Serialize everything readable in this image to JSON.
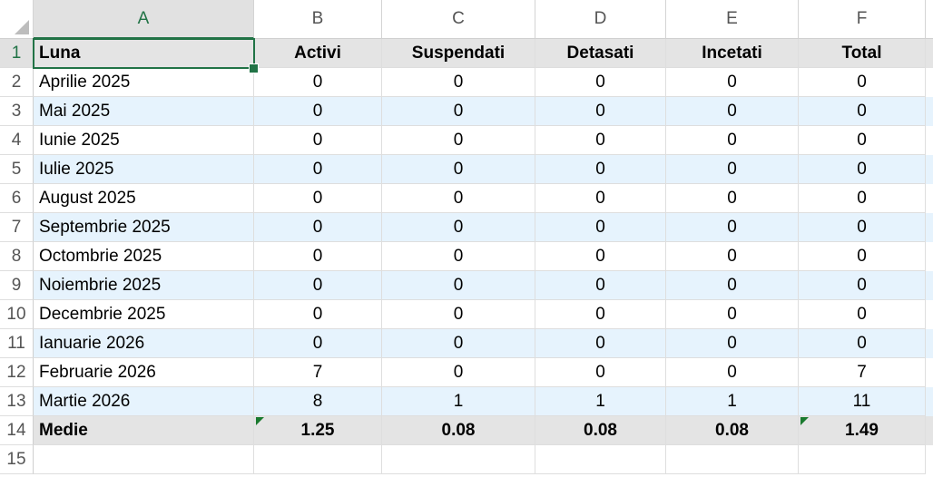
{
  "columns": [
    "A",
    "B",
    "C",
    "D",
    "E",
    "F"
  ],
  "selected_column": "A",
  "selected_row": 1,
  "header_row": {
    "row": "1",
    "cells": [
      "Luna",
      "Activi",
      "Suspendati",
      "Detasati",
      "Incetati",
      "Total"
    ]
  },
  "data_rows": [
    {
      "row": "2",
      "cells": [
        "Aprilie 2025",
        "0",
        "0",
        "0",
        "0",
        "0"
      ]
    },
    {
      "row": "3",
      "cells": [
        "Mai 2025",
        "0",
        "0",
        "0",
        "0",
        "0"
      ]
    },
    {
      "row": "4",
      "cells": [
        "Iunie 2025",
        "0",
        "0",
        "0",
        "0",
        "0"
      ]
    },
    {
      "row": "5",
      "cells": [
        "Iulie 2025",
        "0",
        "0",
        "0",
        "0",
        "0"
      ]
    },
    {
      "row": "6",
      "cells": [
        "August 2025",
        "0",
        "0",
        "0",
        "0",
        "0"
      ]
    },
    {
      "row": "7",
      "cells": [
        "Septembrie 2025",
        "0",
        "0",
        "0",
        "0",
        "0"
      ]
    },
    {
      "row": "8",
      "cells": [
        "Octombrie 2025",
        "0",
        "0",
        "0",
        "0",
        "0"
      ]
    },
    {
      "row": "9",
      "cells": [
        "Noiembrie 2025",
        "0",
        "0",
        "0",
        "0",
        "0"
      ]
    },
    {
      "row": "10",
      "cells": [
        "Decembrie 2025",
        "0",
        "0",
        "0",
        "0",
        "0"
      ]
    },
    {
      "row": "11",
      "cells": [
        "Ianuarie 2026",
        "0",
        "0",
        "0",
        "0",
        "0"
      ]
    },
    {
      "row": "12",
      "cells": [
        "Februarie 2026",
        "7",
        "0",
        "0",
        "0",
        "7"
      ]
    },
    {
      "row": "13",
      "cells": [
        "Martie 2026",
        "8",
        "1",
        "1",
        "1",
        "11"
      ]
    }
  ],
  "summary_row": {
    "row": "14",
    "cells": [
      "Medie",
      "1.25",
      "0.08",
      "0.08",
      "0.08",
      "1.49"
    ]
  },
  "empty_row": {
    "row": "15"
  },
  "colors": {
    "header_fill": "#e4e4e4",
    "band_fill": "#e6f3fd",
    "selection": "#217346",
    "error_indicator": "#1a7a2e"
  }
}
